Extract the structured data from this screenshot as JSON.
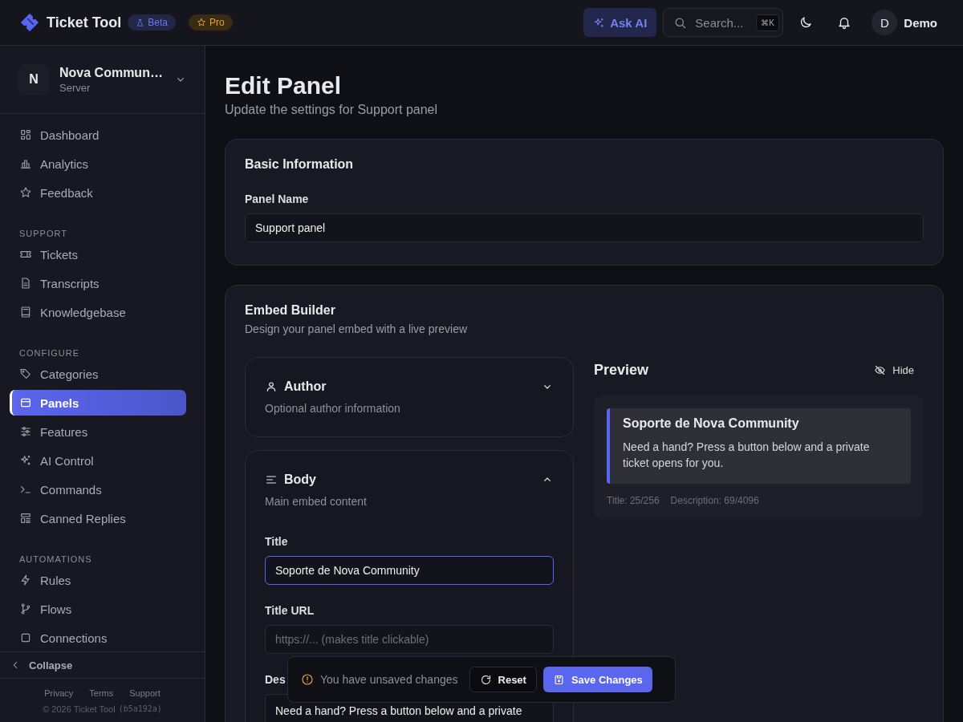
{
  "app": {
    "name": "Ticket Tool",
    "badges": [
      {
        "label": "Beta",
        "kind": "beta"
      },
      {
        "label": "Pro",
        "kind": "pro"
      }
    ]
  },
  "topbar": {
    "ask_ai": "Ask AI",
    "search": {
      "placeholder": "Search...",
      "shortcut": "⌘K"
    },
    "user": {
      "initial": "D",
      "name": "Demo"
    }
  },
  "server": {
    "initial": "N",
    "name": "Nova Commun…",
    "type": "Server"
  },
  "sidebar": {
    "sections": [
      {
        "items": [
          {
            "label": "Dashboard",
            "selected": false
          },
          {
            "label": "Analytics",
            "selected": false
          },
          {
            "label": "Feedback",
            "selected": false
          }
        ]
      },
      {
        "heading": "SUPPORT",
        "items": [
          {
            "label": "Tickets",
            "selected": false
          },
          {
            "label": "Transcripts",
            "selected": false
          },
          {
            "label": "Knowledgebase",
            "selected": false
          }
        ]
      },
      {
        "heading": "CONFIGURE",
        "items": [
          {
            "label": "Categories",
            "selected": false
          },
          {
            "label": "Panels",
            "selected": true
          },
          {
            "label": "Features",
            "selected": false
          },
          {
            "label": "AI Control",
            "selected": false
          },
          {
            "label": "Commands",
            "selected": false
          },
          {
            "label": "Canned Replies",
            "selected": false
          }
        ]
      },
      {
        "heading": "AUTOMATIONS",
        "items": [
          {
            "label": "Rules",
            "selected": false
          },
          {
            "label": "Flows",
            "selected": false
          },
          {
            "label": "Connections",
            "selected": false
          }
        ]
      }
    ],
    "collapse": "Collapse",
    "footer_links": [
      "Privacy",
      "Terms",
      "Support"
    ],
    "copyright": "© 2026 Ticket Tool",
    "build": "(b5a192a)"
  },
  "page": {
    "title": "Edit Panel",
    "subtitle": "Update the settings for Support panel"
  },
  "basic_info": {
    "title": "Basic Information",
    "field": {
      "label": "Panel Name",
      "value": "Support panel"
    }
  },
  "embed_builder": {
    "title": "Embed Builder",
    "subtitle": "Design your panel embed with a live preview",
    "sections": [
      {
        "title": "Author",
        "subtitle": "Optional author information",
        "expanded": false
      },
      {
        "title": "Body",
        "subtitle": "Main embed content",
        "expanded": true,
        "fields": [
          {
            "kind": "input",
            "label": "Title",
            "value": "Soporte de Nova Community",
            "focused": true
          },
          {
            "kind": "input",
            "label": "Title URL",
            "placeholder": "https://... (makes title clickable)",
            "focused": false
          },
          {
            "kind": "textarea",
            "label": "Des",
            "value": "Need a hand? Press a button below and a private",
            "focused": false
          }
        ]
      }
    ],
    "preview": {
      "title": "Preview",
      "hide": "Hide",
      "embed_title": "Soporte de Nova Community",
      "embed_description": "Need a hand? Press a button below and a private ticket opens for you.",
      "counts": [
        "Title: 25/256",
        "Description: 69/4096"
      ]
    }
  },
  "unsaved_bar": {
    "message": "You have unsaved changes",
    "reset": "Reset",
    "save": "Save Changes"
  }
}
